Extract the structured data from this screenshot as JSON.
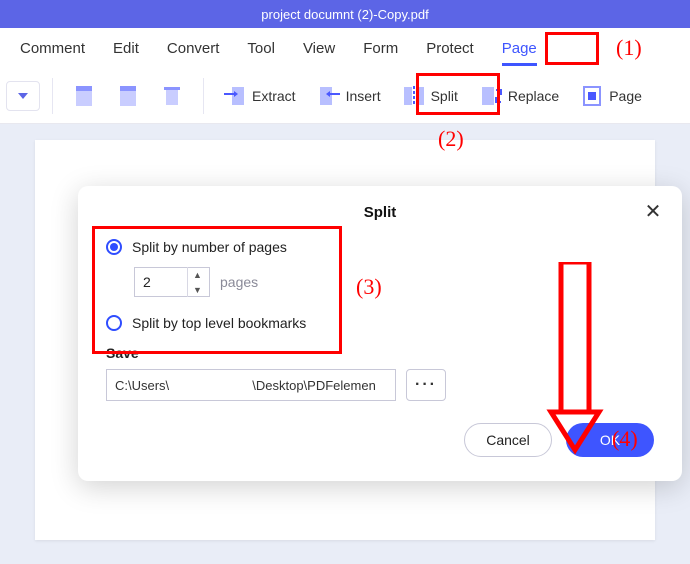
{
  "titlebar": {
    "filename": "project documnt (2)-Copy.pdf"
  },
  "menu": {
    "comment": "Comment",
    "edit": "Edit",
    "convert": "Convert",
    "tool": "Tool",
    "view": "View",
    "form": "Form",
    "protect": "Protect",
    "page": "Page"
  },
  "toolbar": {
    "extract": "Extract",
    "insert": "Insert",
    "split": "Split",
    "replace": "Replace",
    "page_label": "Page"
  },
  "dialog": {
    "title": "Split",
    "option_pages_label": "Split by number of pages",
    "page_count": "2",
    "unit": "pages",
    "option_bookmarks_label": "Split by top level bookmarks",
    "save_label": "Save",
    "path_value": "C:\\Users\\                       \\Desktop\\PDFelemen",
    "browse_label": "···",
    "cancel": "Cancel",
    "ok": "OK"
  },
  "annotations": {
    "n1": "(1)",
    "n2": "(2)",
    "n3": "(3)",
    "n4": "(4)"
  }
}
